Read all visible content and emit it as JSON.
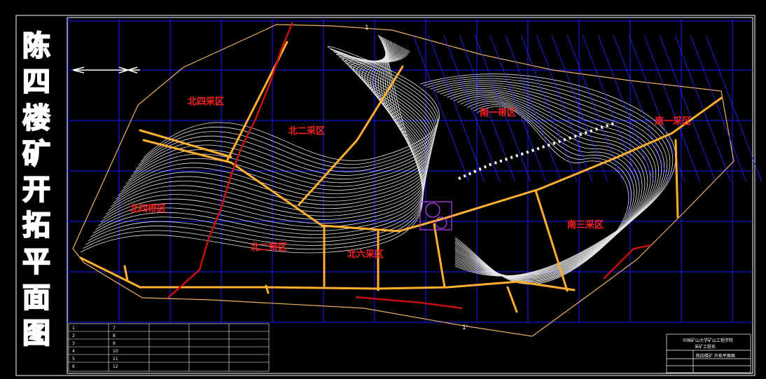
{
  "drawing": {
    "title_chars": [
      "陈",
      "四",
      "楼",
      "矿",
      "开",
      "拓",
      "平",
      "面",
      "图"
    ],
    "zones": [
      "北四采区",
      "北二采区",
      "南一带区",
      "南一采区",
      "北四带区",
      "北二带区",
      "北六采区",
      "南三采区"
    ],
    "north_label": "1",
    "south_label": "1'"
  },
  "title_block": {
    "org": "中国矿山大学矿山工程学院",
    "dept": "采矿工程系",
    "drawing_name": "陈四楼矿 开拓平面图"
  },
  "legend_table": {
    "numbers": [
      "1",
      "2",
      "3",
      "4",
      "5",
      "6",
      "7",
      "8",
      "9",
      "10",
      "11",
      "12"
    ]
  },
  "colors": {
    "grid": "#1a1aff",
    "contour": "#ffffff",
    "roadway": "#ffb030",
    "fault": "#c81010",
    "zone_label": "#ff2020"
  }
}
